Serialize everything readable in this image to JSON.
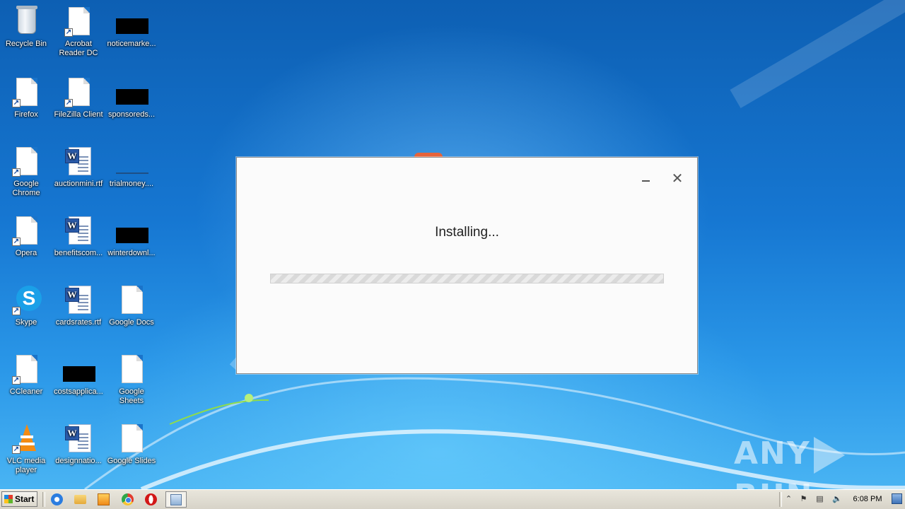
{
  "desktop": {
    "icons": [
      {
        "label": "Recycle Bin",
        "icon": "recycle-bin-icon"
      },
      {
        "label": "Acrobat Reader DC",
        "icon": "acrobat-shortcut-icon"
      },
      {
        "label": "noticemarke...",
        "icon": "black-file-icon"
      },
      {
        "label": "Firefox",
        "icon": "firefox-shortcut-icon"
      },
      {
        "label": "FileZilla Client",
        "icon": "filezilla-shortcut-icon"
      },
      {
        "label": "sponsoreds...",
        "icon": "black-file-icon"
      },
      {
        "label": "Google Chrome",
        "icon": "chrome-shortcut-icon"
      },
      {
        "label": "auctionmini.rtf",
        "icon": "word-document-icon"
      },
      {
        "label": "trialmoney....",
        "icon": "file-icon"
      },
      {
        "label": "Opera",
        "icon": "opera-shortcut-icon"
      },
      {
        "label": "benefitscom...",
        "icon": "word-document-icon"
      },
      {
        "label": "winterdownl...",
        "icon": "black-file-icon"
      },
      {
        "label": "Skype",
        "icon": "skype-shortcut-icon"
      },
      {
        "label": "cardsrates.rtf",
        "icon": "word-document-icon"
      },
      {
        "label": "Google Docs",
        "icon": "blank-document-icon"
      },
      {
        "label": "CCleaner",
        "icon": "ccleaner-shortcut-icon"
      },
      {
        "label": "costsapplica...",
        "icon": "black-file-icon"
      },
      {
        "label": "Google Sheets",
        "icon": "blank-document-icon"
      },
      {
        "label": "VLC media player",
        "icon": "vlc-shortcut-icon"
      },
      {
        "label": "designnatio...",
        "icon": "word-document-icon"
      },
      {
        "label": "Google Slides",
        "icon": "blank-document-icon"
      }
    ]
  },
  "installer": {
    "title": "Installing...",
    "minimize_glyph": "",
    "close_glyph": "✕",
    "progress_fraction": 0.0
  },
  "watermark": {
    "left": "ANY",
    "right": "RUN"
  },
  "taskbar": {
    "start_label": "Start",
    "pinned": [
      "internet-explorer-icon",
      "windows-explorer-icon",
      "media-player-icon",
      "chrome-icon",
      "opera-icon",
      "installer-icon"
    ],
    "tray": {
      "show_hidden_glyph": "⌃",
      "flag_glyph": "⚑",
      "network_glyph": "▤",
      "volume_glyph": "🔈",
      "time": "6:08 PM"
    }
  },
  "colors": {
    "desktop_blue": "#1a73c9",
    "window_bg": "#fbfbfb",
    "progress_stripe": "#d9d9d9"
  }
}
